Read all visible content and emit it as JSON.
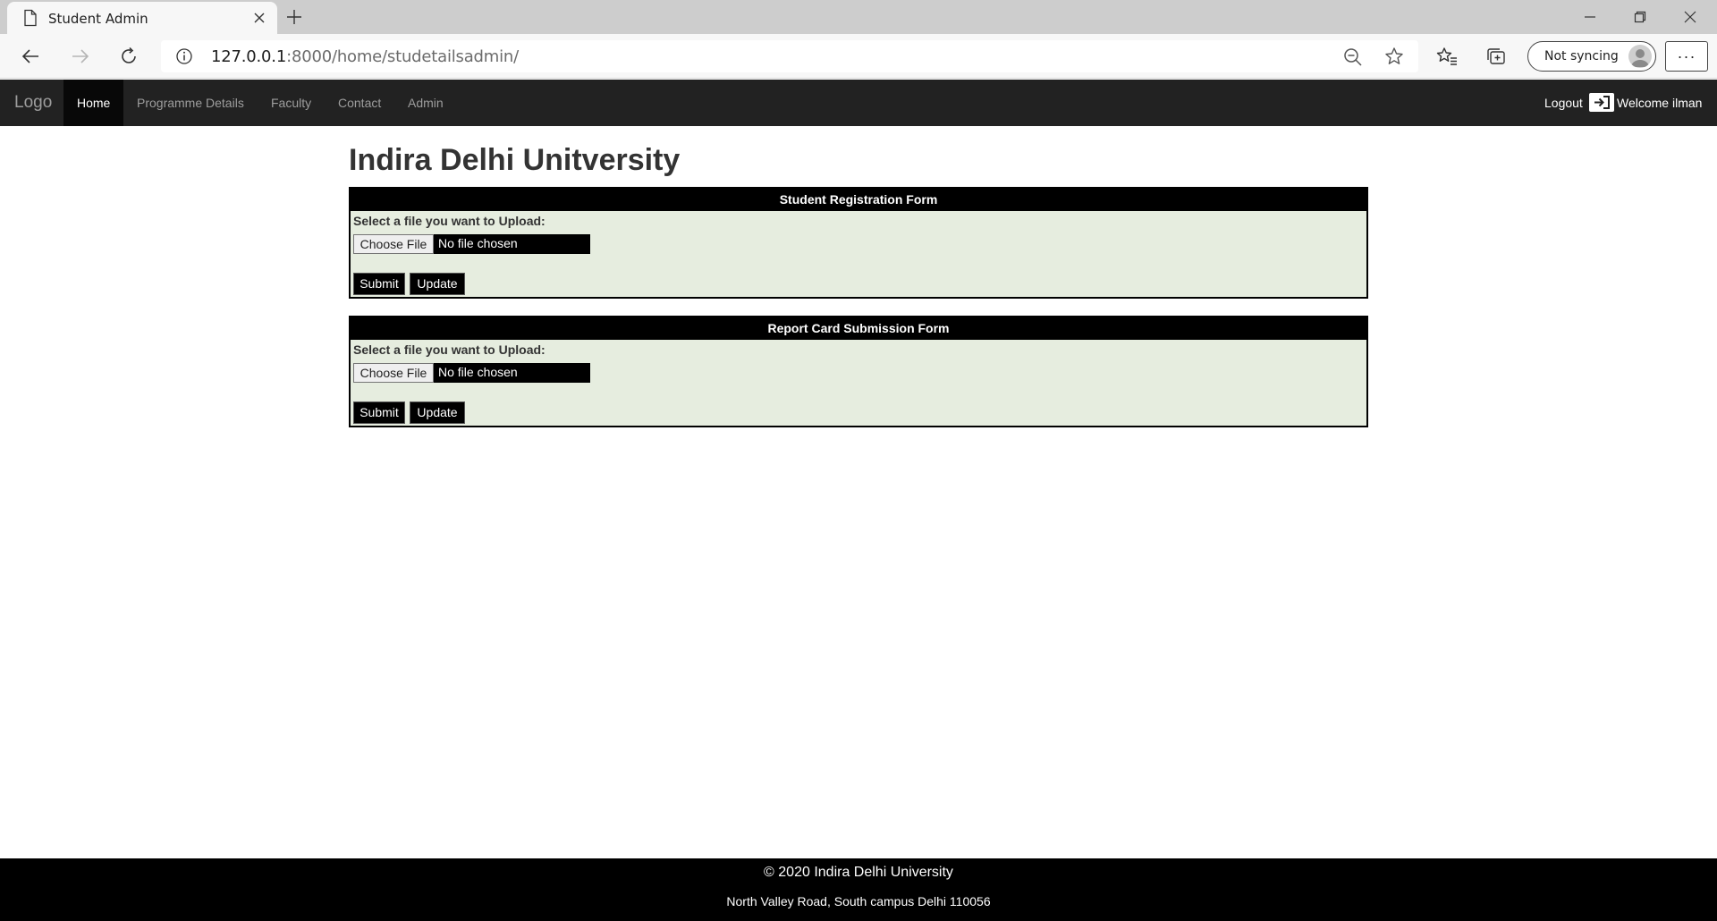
{
  "browser": {
    "tab_title": "Student Admin",
    "url_host": "127.0.0.1",
    "url_rest": ":8000/home/studetailsadmin/",
    "sync_label": "Not syncing"
  },
  "navbar": {
    "brand": "Logo",
    "items": [
      {
        "label": "Home",
        "active": true
      },
      {
        "label": "Programme Details",
        "active": false
      },
      {
        "label": "Faculty",
        "active": false
      },
      {
        "label": "Contact",
        "active": false
      },
      {
        "label": "Admin",
        "active": false
      }
    ],
    "logout_label": "Logout",
    "welcome_label": "Welcome ilman"
  },
  "page": {
    "title": "Indira Delhi Unitversity"
  },
  "forms": [
    {
      "header": "Student Registration Form",
      "prompt": "Select a file you want to Upload:",
      "choose_label": "Choose File",
      "file_status": "No file chosen",
      "submit_label": "Submit",
      "update_label": "Update"
    },
    {
      "header": "Report Card Submission Form",
      "prompt": "Select a file you want to Upload:",
      "choose_label": "Choose File",
      "file_status": "No file chosen",
      "submit_label": "Submit",
      "update_label": "Update"
    }
  ],
  "footer": {
    "copyright": "© 2020 Indira Delhi University",
    "address": "North Valley Road, South campus Delhi 110056"
  }
}
